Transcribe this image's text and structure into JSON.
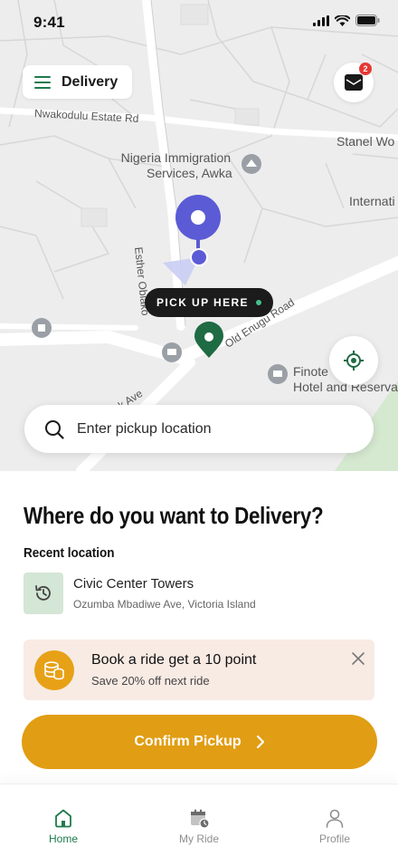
{
  "status_bar": {
    "time": "9:41"
  },
  "header": {
    "menu_label": "Delivery",
    "notification_count": "2"
  },
  "map": {
    "labels": {
      "nwakodulu": "Nwakodulu Estate Rd",
      "immigration_line1": "Nigeria Immigration",
      "immigration_line2": "Services, Awka",
      "stanel": "Stanel Wo",
      "internat": "Internati",
      "esther": "Esther Obiako",
      "old_enugu": "Old Enugu Road",
      "ave": "k Ave",
      "hotel_line1": "Finote",
      "hotel_line2": "Hotel and Reserva"
    },
    "pickup_pill": "PICK UP HERE",
    "colors": {
      "user_pin": "#5b5bd6",
      "pickup_pin": "#1f6b43"
    }
  },
  "search": {
    "placeholder": "Enter pickup location"
  },
  "sheet": {
    "title": "Where do you want to Delivery?",
    "recent_label": "Recent location",
    "recent": {
      "name": "Civic Center Towers",
      "address": "Ozumba Mbadiwe Ave, Victoria Island",
      "icon": "history-icon"
    },
    "promo": {
      "title": "Book a ride get a 10 point",
      "subtitle": "Save 20% off next ride",
      "icon": "coins-icon"
    },
    "confirm_label": "Confirm Pickup"
  },
  "nav": [
    {
      "label": "Home",
      "icon": "home-icon",
      "active": true
    },
    {
      "label": "My Ride",
      "icon": "calendar-clock-icon",
      "active": false
    },
    {
      "label": "Profile",
      "icon": "profile-icon",
      "active": false
    }
  ],
  "colors": {
    "accent_green": "#1f7a4d",
    "accent_orange": "#e19d13",
    "promo_bg": "#f8ebe4"
  }
}
